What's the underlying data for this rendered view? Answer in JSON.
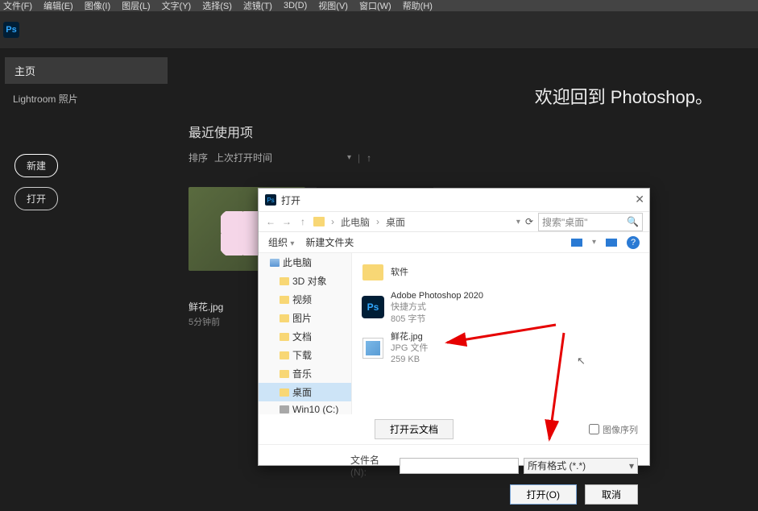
{
  "menu": [
    "文件(F)",
    "编辑(E)",
    "图像(I)",
    "图层(L)",
    "文字(Y)",
    "选择(S)",
    "滤镜(T)",
    "3D(D)",
    "视图(V)",
    "窗口(W)",
    "帮助(H)"
  ],
  "sidebar": {
    "home": "主页",
    "lightroom": "Lightroom 照片",
    "new": "新建",
    "open": "打开"
  },
  "content": {
    "welcome": "欢迎回到 Photoshop。",
    "section": "最近使用项",
    "sort_label": "排序",
    "sort_value": "上次打开时间",
    "thumb1_name": "鲜花.jpg",
    "thumb1_time": "5分钟前"
  },
  "dialog": {
    "title": "打开",
    "nav": {
      "pc": "此电脑",
      "desktop": "桌面",
      "search_placeholder": "搜索\"桌面\""
    },
    "toolbar": {
      "organize": "组织",
      "newfolder": "新建文件夹"
    },
    "tree": {
      "pc": "此电脑",
      "items": [
        "3D 对象",
        "视频",
        "图片",
        "文档",
        "下载",
        "音乐",
        "桌面",
        "Win10 (C:)"
      ]
    },
    "files": [
      {
        "name": "软件",
        "type": "folder"
      },
      {
        "name": "Adobe Photoshop 2020",
        "line2": "快捷方式",
        "line3": "805 字节",
        "type": "ps"
      },
      {
        "name": "鲜花.jpg",
        "line2": "JPG 文件",
        "line3": "259 KB",
        "type": "jpg"
      }
    ],
    "cloud_btn": "打开云文档",
    "imgseq": "图像序列",
    "filename_label": "文件名(N):",
    "filter": "所有格式 (*.*)",
    "open_btn": "打开(O)",
    "cancel_btn": "取消"
  }
}
